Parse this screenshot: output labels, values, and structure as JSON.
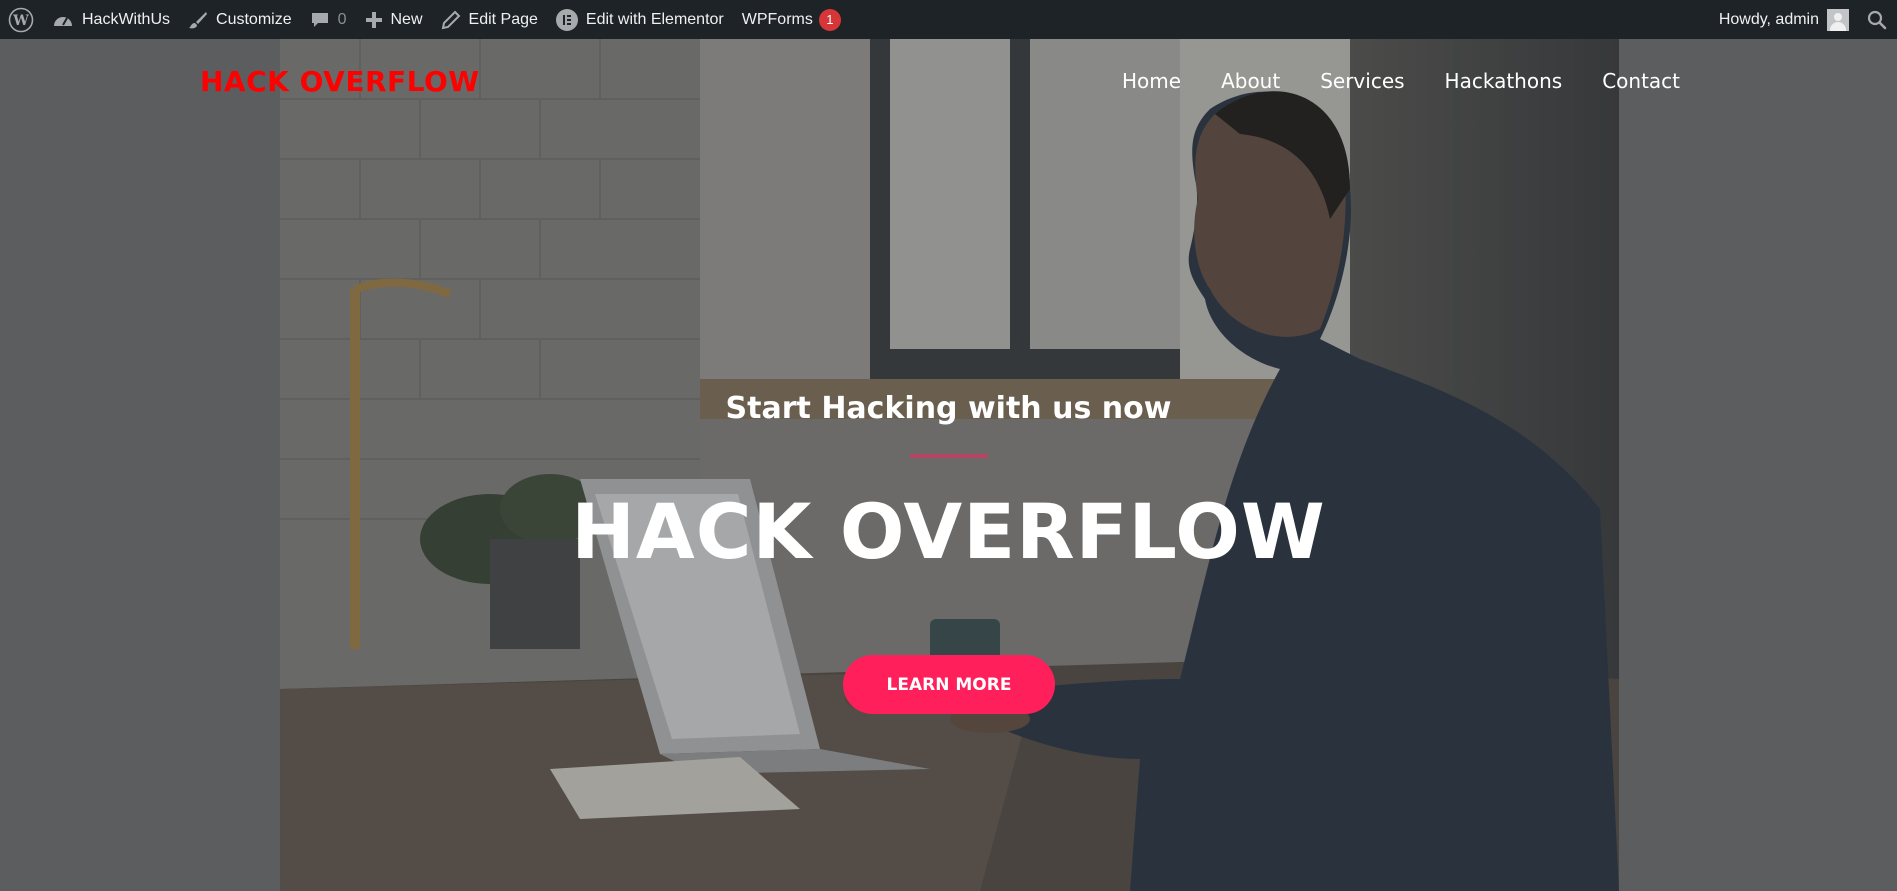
{
  "admin_bar": {
    "site_name": "HackWithUs",
    "customize": "Customize",
    "comments_count": "0",
    "new": "New",
    "edit_page": "Edit Page",
    "edit_elementor": "Edit with Elementor",
    "wpforms": "WPForms",
    "wpforms_badge": "1",
    "greeting": "Howdy, admin",
    "icons": [
      "wordpress-icon",
      "dashboard-icon",
      "brush-icon",
      "comment-icon",
      "plus-icon",
      "pencil-icon",
      "elementor-icon",
      "avatar",
      "search-icon"
    ]
  },
  "header": {
    "logo": "HACK OVERFLOW",
    "logo_color": "#ff0000",
    "nav": [
      "Home",
      "About",
      "Services",
      "Hackathons",
      "Contact"
    ]
  },
  "hero": {
    "tagline": "Start Hacking with us now",
    "title": "HACK OVERFLOW",
    "button": "LEARN MORE",
    "accent_color": "#ff1f5a"
  }
}
